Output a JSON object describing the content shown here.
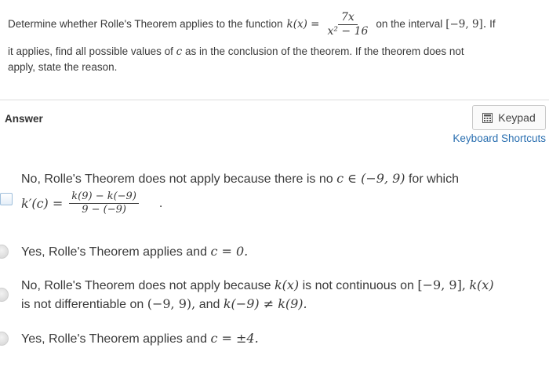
{
  "question": {
    "prefix": "Determine whether Rolle's Theorem applies to the function",
    "function_lhs": "k(x) =",
    "numerator": "7x",
    "denominator": "x² − 16",
    "interval_text": "on the interval",
    "interval": "[−9, 9].",
    "suffix_if": "If",
    "line2": "it applies, find all possible values of",
    "line2_var": "c",
    "line2_rest": "as in the conclusion of the theorem. If the theorem does not",
    "line3": "apply, state the reason."
  },
  "answer": {
    "label": "Answer",
    "keypad_label": "Keypad",
    "keyboard_shortcuts_label": "Keyboard Shortcuts"
  },
  "options": [
    {
      "type": "checkbox",
      "line1_prefix": "No, Rolle's Theorem does not apply because there is no",
      "line1_math": "c ∈ (−9, 9)",
      "line1_suffix": "for which",
      "line2_lhs": "k′(c) =",
      "frac_num": "k(9) − k(−9)",
      "frac_den": "9 − (−9)",
      "line2_end": "."
    },
    {
      "type": "radio",
      "text": "Yes, Rolle's Theorem applies and",
      "math": "c = 0."
    },
    {
      "type": "radio",
      "line1_prefix": "No, Rolle's Theorem does not apply because",
      "line1_math1": "k(x)",
      "line1_mid": "is not continuous on",
      "line1_math2": "[−9, 9],",
      "line1_math3": "k(x)",
      "line2_prefix": "is not differentiable on",
      "line2_math1": "(−9, 9),",
      "line2_mid": "and",
      "line2_math2": "k(−9) ≠ k(9)."
    },
    {
      "type": "radio",
      "text": "Yes, Rolle's Theorem applies and",
      "math": "c = ±4."
    }
  ]
}
